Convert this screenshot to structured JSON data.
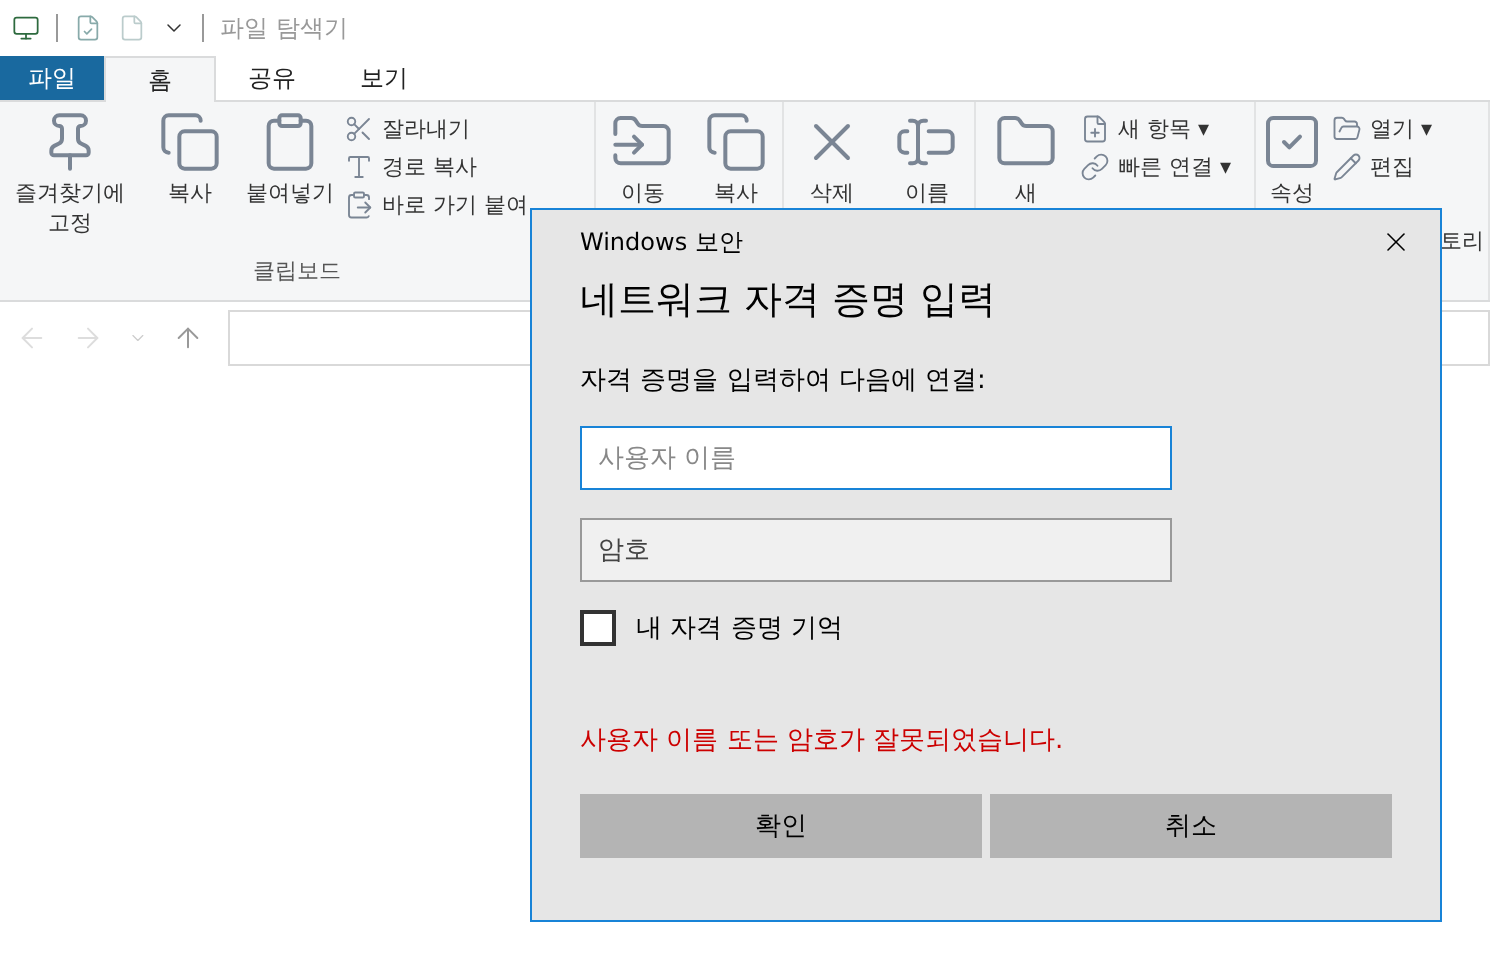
{
  "window": {
    "title": "파일 탐색기"
  },
  "ribbon_tabs": [
    {
      "label": "파일",
      "kind": "file",
      "selected": false
    },
    {
      "label": "홈",
      "kind": "tab",
      "selected": true
    },
    {
      "label": "공유",
      "kind": "tab",
      "selected": false
    },
    {
      "label": "보기",
      "kind": "tab",
      "selected": false
    }
  ],
  "ribbon_groups": [
    {
      "label": "클립보드",
      "large": [
        "즐겨찾기에 고정",
        "복사",
        "붙여넣기"
      ],
      "small": [
        "잘라내기",
        "경로 복사",
        "바로 가기 붙여"
      ]
    },
    {
      "large": [
        "이동",
        "복사"
      ]
    },
    {
      "large": [
        "삭제",
        "이름"
      ]
    },
    {
      "large": [
        "새"
      ],
      "small": [
        "새 항목 ▾",
        "빠른 연결 ▾"
      ]
    },
    {
      "large": [
        "속성"
      ],
      "small": [
        "열기 ▾",
        "편집"
      ],
      "trailing": "토리"
    }
  ],
  "dialog": {
    "title": "Windows 보안",
    "heading": "네트워크 자격 증명 입력",
    "prompt": "자격 증명을 입력하여 다음에 연결:",
    "username": {
      "placeholder": "사용자 이름",
      "focused": true
    },
    "password": {
      "placeholder": "암호"
    },
    "remember": {
      "label": "내 자격 증명 기억",
      "checked": false
    },
    "error": "사용자 이름 또는 암호가 잘못되었습니다.",
    "buttons": [
      "확인",
      "취소"
    ]
  }
}
